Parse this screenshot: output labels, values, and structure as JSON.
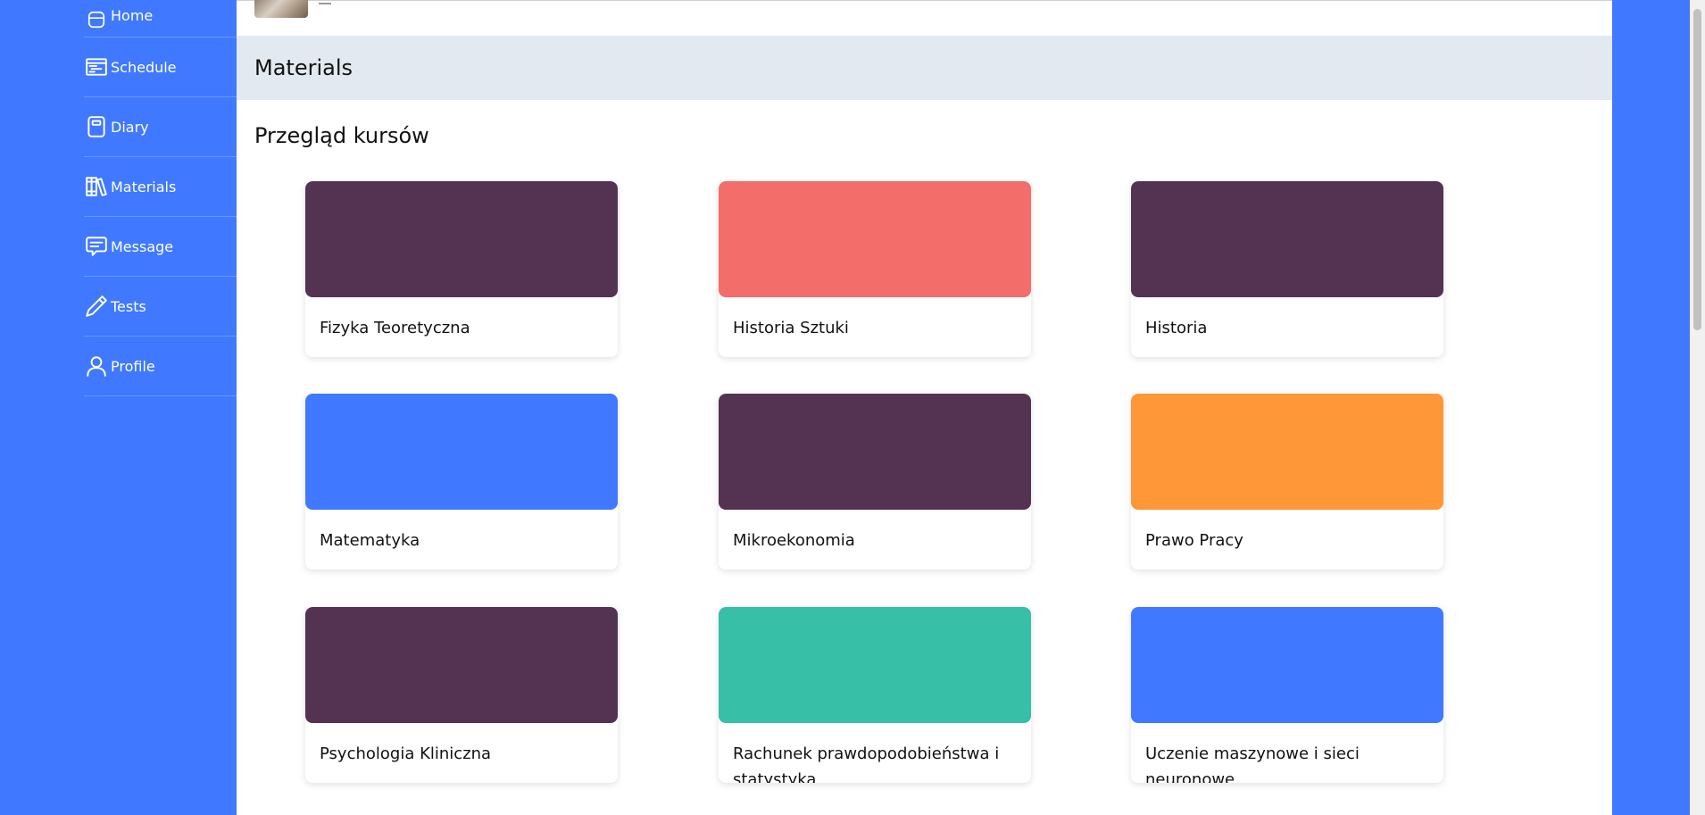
{
  "sidebar": {
    "items": [
      {
        "label": "Home",
        "icon": "home-icon"
      },
      {
        "label": "Schedule",
        "icon": "schedule-icon"
      },
      {
        "label": "Diary",
        "icon": "diary-icon"
      },
      {
        "label": "Materials",
        "icon": "books-icon"
      },
      {
        "label": "Message",
        "icon": "message-icon"
      },
      {
        "label": "Tests",
        "icon": "pencil-icon"
      },
      {
        "label": "Profile",
        "icon": "profile-icon"
      }
    ]
  },
  "header": {
    "title": "Materials"
  },
  "main": {
    "subtitle": "Przegląd kursów",
    "courses": [
      {
        "title": "Fizyka Teoretyczna",
        "color": "#543352"
      },
      {
        "title": "Historia Sztuki",
        "color": "#f36d6b"
      },
      {
        "title": "Historia",
        "color": "#543352"
      },
      {
        "title": "Matematyka",
        "color": "#4079ff"
      },
      {
        "title": "Mikroekonomia",
        "color": "#543352"
      },
      {
        "title": "Prawo Pracy",
        "color": "#fd9737"
      },
      {
        "title": "Psychologia Kliniczna",
        "color": "#543352"
      },
      {
        "title": "Rachunek prawdopodobieństwa i statystyka",
        "color": "#38bfa7"
      },
      {
        "title": "Uczenie maszynowe i sieci neuronowe",
        "color": "#4079ff"
      }
    ]
  }
}
